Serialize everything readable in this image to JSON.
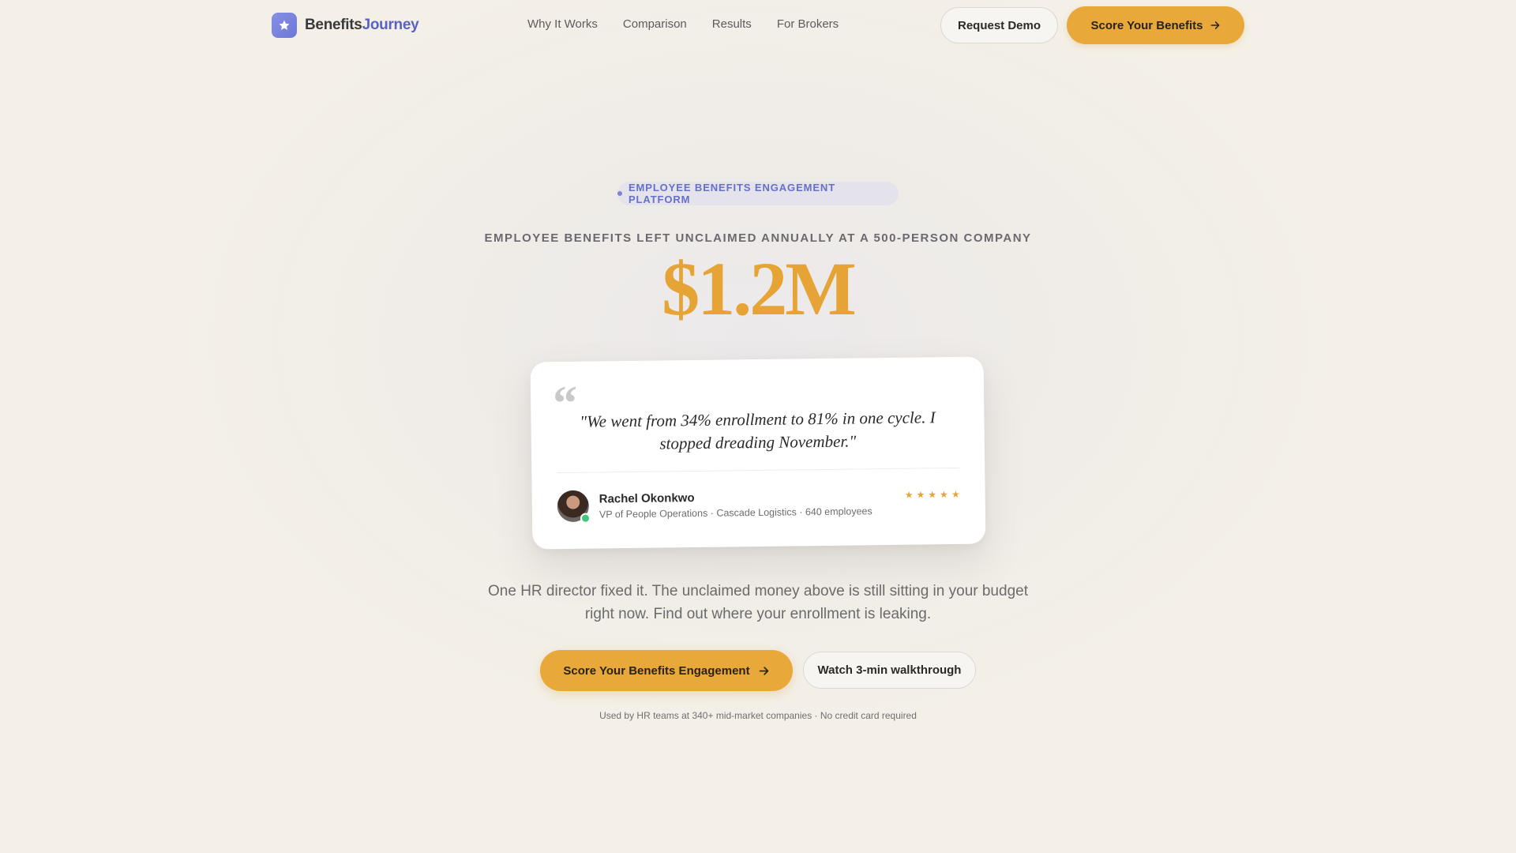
{
  "nav": {
    "brand": {
      "part1": "Benefits",
      "part2": "Journey",
      "logo_icon": "star-icon"
    },
    "links": [
      "Why It Works",
      "Comparison",
      "Results",
      "For Brokers"
    ],
    "request_demo": "Request Demo",
    "score_cta": "Score Your Benefits"
  },
  "hero": {
    "badge": "EMPLOYEE BENEFITS ENGAGEMENT PLATFORM",
    "eyebrow": "EMPLOYEE BENEFITS LEFT UNCLAIMED ANNUALLY AT A 500-PERSON COMPANY",
    "amount": "$1.2M",
    "subcopy": "One HR director fixed it. The unclaimed money above is still sitting in your budget right now. Find out where your enrollment is leaking.",
    "primary_cta": "Score Your Benefits Engagement",
    "secondary_cta": "Watch 3-min walkthrough",
    "trust_note": "Used by HR teams at 340+ mid-market companies · No credit card required"
  },
  "testimonial": {
    "quote_mark": "“",
    "quote": "\"We went from 34% enrollment to 81% in one cycle. I stopped dreading November.\"",
    "name": "Rachel Okonkwo",
    "role": "VP of People Operations · Cascade Logistics · 640 employees",
    "rating": 5,
    "star_glyph": "★"
  },
  "colors": {
    "accent": "#e8a93a",
    "amount": "#e6a436",
    "brand_blue": "#5863c4",
    "status_online": "#3fc77b"
  }
}
